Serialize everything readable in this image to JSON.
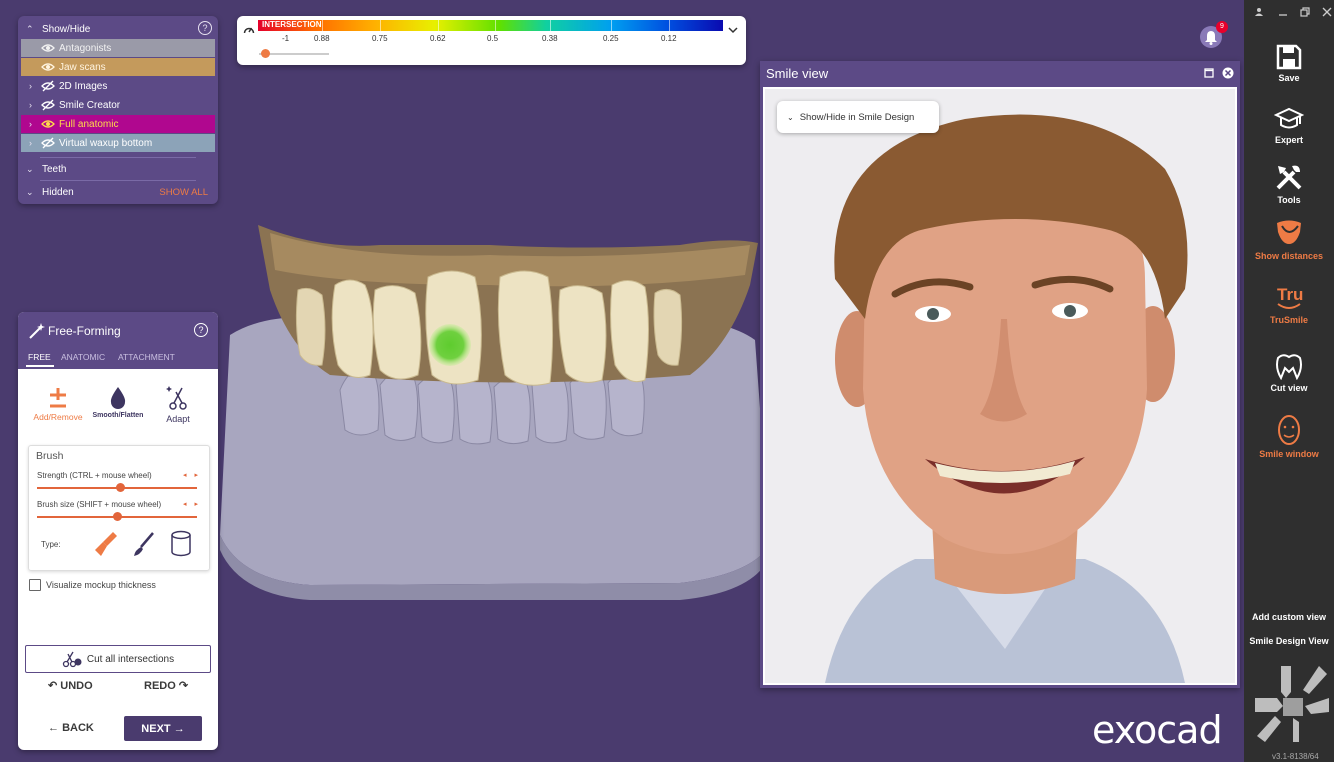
{
  "show_hide": {
    "title": "Show/Hide",
    "help": "?",
    "items": [
      {
        "label": "Antagonists",
        "bg": "#9a9aa8",
        "text": "#f2f2f2"
      },
      {
        "label": "Jaw scans",
        "bg": "#c49a5c",
        "text": "#fff4e0"
      },
      {
        "label": "2D Images",
        "bg": "transparent",
        "text": "#ffffff"
      },
      {
        "label": "Smile Creator",
        "bg": "transparent",
        "text": "#ffffff"
      },
      {
        "label": "Full anatomic",
        "bg": "#b0078f",
        "text": "#ffdc4a"
      },
      {
        "label": "Virtual waxup bottom",
        "bg": "#8ca3b8",
        "text": "#ffffff"
      }
    ],
    "teeth": "Teeth",
    "hidden": "Hidden",
    "show_all": "SHOW ALL"
  },
  "intersection": {
    "label": "INTERSECTION",
    "ticks": [
      "-1",
      "0.88",
      "0.75",
      "0.62",
      "0.5",
      "0.38",
      "0.25",
      "0.12"
    ],
    "slider_value": -1
  },
  "free_forming": {
    "title": "Free-Forming",
    "help": "?",
    "tabs": [
      "FREE",
      "ANATOMIC",
      "ATTACHMENT"
    ],
    "active_tab": "FREE",
    "tools": {
      "add_remove": "Add/Remove",
      "smooth_flatten": "Smooth/Flatten",
      "adapt": "Adapt"
    },
    "brush": {
      "title": "Brush",
      "strength_label": "Strength (CTRL + mouse wheel)",
      "size_label": "Brush size (SHIFT + mouse wheel)",
      "type_label": "Type:",
      "strength_value": 0.52,
      "size_value": 0.5
    },
    "visualize_label": "Visualize mockup thickness",
    "cut_label": "Cut all intersections",
    "undo": "UNDO",
    "redo": "REDO",
    "back": "BACK",
    "next": "NEXT"
  },
  "smile_view": {
    "title": "Smile view",
    "dropdown": "Show/Hide in Smile Design"
  },
  "toolbar": {
    "save": "Save",
    "expert": "Expert",
    "tools": "Tools",
    "show_distances": "Show distances",
    "trusmile": "TruSmile",
    "cut_view": "Cut view",
    "smile_window": "Smile window",
    "add_custom_view": "Add custom view",
    "smile_design_view": "Smile Design View",
    "version": "v3.1-8138/64"
  },
  "notifications": {
    "count": "9"
  },
  "logo": "exocad",
  "colors": {
    "accent": "#ee7b45",
    "panel": "#5c4a86",
    "background": "#4a3b6e"
  }
}
